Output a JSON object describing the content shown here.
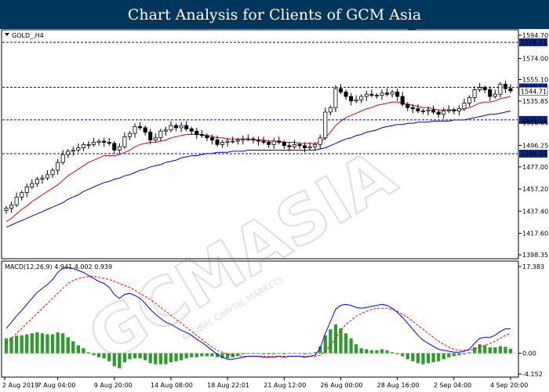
{
  "title": "Chart Analysis for Clients of GCM Asia",
  "chart_data": {
    "type": "candlestick",
    "symbol_label": "GOLD_,H4",
    "indicator_label": "MACD(12,26,9) 4.941 4.002 0.939",
    "price_axis": {
      "ylim": [
        1398.35,
        1594.7
      ],
      "tick_labels": [
        "1594.70",
        "1574.00",
        "1555.10",
        "1535.85",
        "1516.65",
        "1496.25",
        "1477.00",
        "1457.20",
        "1437.40",
        "1417.60",
        "1398.35"
      ],
      "tick_values": [
        1594.7,
        1574.0,
        1555.1,
        1535.85,
        1516.65,
        1496.25,
        1477.0,
        1457.2,
        1437.4,
        1417.6,
        1398.35
      ]
    },
    "horizontal_levels": [
      {
        "value": 1588.41,
        "label": "1588.41"
      },
      {
        "value": 1548.12,
        "label": "1548.12"
      },
      {
        "value": 1519.01,
        "label": "1519.01"
      },
      {
        "value": 1488.84,
        "label": "1488.84"
      }
    ],
    "current_price_label": "1544.71",
    "current_price": 1544.71,
    "macd_axis": {
      "ylim": [
        -4.152,
        17.383
      ],
      "tick_labels": [
        "17.383",
        "0.00",
        "-4.152"
      ],
      "tick_values": [
        17.383,
        0.0,
        -4.152
      ]
    },
    "x_labels": [
      "2 Aug 2019",
      "7 Aug 04:00",
      "9 Aug 20:00",
      "14 Aug 08:00",
      "18 Aug 22:01",
      "21 Aug 12:00",
      "26 Aug 00:00",
      "28 Aug 16:00",
      "2 Sep 04:00",
      "4 Sep 20:00"
    ],
    "x_label_index": [
      0,
      10,
      21,
      32,
      43,
      54,
      65,
      76,
      87,
      98
    ],
    "candles_close": [
      1440,
      1443,
      1450,
      1454,
      1459,
      1462,
      1466,
      1467,
      1470,
      1474,
      1481,
      1488,
      1491,
      1492,
      1494,
      1497,
      1497,
      1499,
      1500,
      1499,
      1498,
      1492,
      1495,
      1504,
      1507,
      1513,
      1512,
      1508,
      1501,
      1503,
      1509,
      1510,
      1514,
      1512,
      1514,
      1511,
      1509,
      1506,
      1505,
      1503,
      1501,
      1497,
      1499,
      1500,
      1500,
      1501,
      1502,
      1502,
      1501,
      1500,
      1499,
      1497,
      1500,
      1499,
      1496,
      1495,
      1497,
      1496,
      1494,
      1495,
      1497,
      1503,
      1526,
      1530,
      1547,
      1544,
      1540,
      1536,
      1537,
      1540,
      1542,
      1541,
      1541,
      1543,
      1542,
      1544,
      1540,
      1533,
      1530,
      1529,
      1527,
      1527,
      1528,
      1526,
      1524,
      1527,
      1528,
      1527,
      1529,
      1534,
      1539,
      1546,
      1548,
      1546,
      1540,
      1542,
      1551,
      1547,
      1545
    ],
    "ema_fast": [
      1428,
      1431,
      1435,
      1439,
      1442,
      1446,
      1449,
      1452,
      1455,
      1458,
      1461,
      1465,
      1469,
      1472,
      1475,
      1478,
      1481,
      1483,
      1485,
      1487,
      1487,
      1487,
      1488,
      1490,
      1492,
      1495,
      1497,
      1498,
      1499,
      1499,
      1500,
      1501,
      1503,
      1504,
      1505,
      1506,
      1506,
      1506,
      1506,
      1505,
      1504,
      1503,
      1503,
      1502,
      1502,
      1502,
      1502,
      1502,
      1501,
      1501,
      1501,
      1500,
      1500,
      1500,
      1499,
      1499,
      1499,
      1498,
      1498,
      1498,
      1498,
      1499,
      1503,
      1508,
      1514,
      1518,
      1521,
      1523,
      1525,
      1527,
      1529,
      1530,
      1532,
      1533,
      1534,
      1535,
      1535,
      1534,
      1533,
      1532,
      1531,
      1530,
      1530,
      1529,
      1528,
      1528,
      1528,
      1528,
      1528,
      1529,
      1530,
      1532,
      1534,
      1535,
      1535,
      1536,
      1538,
      1539,
      1540
    ],
    "ema_slow": [
      1423,
      1425,
      1427,
      1429,
      1431,
      1433,
      1435,
      1437,
      1439,
      1441,
      1443,
      1445,
      1448,
      1450,
      1452,
      1455,
      1457,
      1459,
      1461,
      1463,
      1464,
      1466,
      1467,
      1469,
      1470,
      1472,
      1474,
      1475,
      1477,
      1478,
      1479,
      1481,
      1482,
      1483,
      1485,
      1486,
      1487,
      1487,
      1488,
      1489,
      1489,
      1490,
      1490,
      1490,
      1491,
      1491,
      1491,
      1492,
      1492,
      1492,
      1492,
      1492,
      1492,
      1492,
      1492,
      1492,
      1492,
      1492,
      1492,
      1492,
      1492,
      1493,
      1494,
      1496,
      1498,
      1500,
      1502,
      1503,
      1505,
      1506,
      1508,
      1509,
      1510,
      1512,
      1513,
      1514,
      1515,
      1515,
      1516,
      1516,
      1517,
      1517,
      1517,
      1518,
      1518,
      1518,
      1518,
      1519,
      1519,
      1519,
      1520,
      1521,
      1522,
      1523,
      1524,
      1524,
      1525,
      1526,
      1527
    ],
    "macd_main": [
      5.0,
      6.2,
      7.5,
      8.6,
      9.8,
      11.0,
      12.2,
      13.0,
      13.8,
      14.8,
      16.2,
      17.0,
      17.2,
      17.0,
      16.6,
      16.2,
      15.6,
      15.0,
      14.4,
      14.0,
      13.2,
      11.8,
      11.0,
      11.8,
      12.0,
      11.6,
      11.0,
      10.0,
      8.8,
      7.8,
      7.0,
      6.2,
      5.8,
      5.2,
      4.6,
      4.2,
      3.6,
      2.8,
      2.2,
      1.4,
      0.6,
      -0.2,
      -0.8,
      -1.2,
      -1.2,
      -1.0,
      -0.8,
      -0.6,
      -0.6,
      -0.6,
      -0.8,
      -0.8,
      -0.8,
      -0.6,
      -0.8,
      -0.6,
      -0.6,
      -0.6,
      -0.8,
      -0.6,
      -0.4,
      1.0,
      4.0,
      6.4,
      8.8,
      9.6,
      9.8,
      9.6,
      9.2,
      9.0,
      9.2,
      9.4,
      9.6,
      9.8,
      9.6,
      9.0,
      8.2,
      7.2,
      6.0,
      4.8,
      3.6,
      2.6,
      2.0,
      1.4,
      0.8,
      0.6,
      0.4,
      0.2,
      0.2,
      0.4,
      0.8,
      2.0,
      3.0,
      3.2,
      3.2,
      3.6,
      4.4,
      4.9,
      4.9
    ],
    "macd_signal": [
      2.0,
      3.0,
      4.0,
      5.0,
      6.0,
      7.0,
      8.0,
      9.0,
      10.0,
      11.0,
      12.0,
      13.0,
      14.0,
      14.6,
      15.0,
      15.2,
      15.4,
      15.4,
      15.2,
      15.0,
      14.8,
      14.4,
      14.0,
      13.6,
      13.2,
      12.6,
      12.0,
      11.4,
      10.8,
      10.0,
      9.2,
      8.4,
      7.6,
      6.8,
      6.0,
      5.2,
      4.4,
      3.6,
      2.8,
      2.0,
      1.2,
      0.6,
      0.2,
      -0.2,
      -0.4,
      -0.5,
      -0.6,
      -0.6,
      -0.6,
      -0.6,
      -0.6,
      -0.6,
      -0.6,
      -0.6,
      -0.6,
      -0.6,
      -0.6,
      -0.6,
      -0.6,
      -0.6,
      -0.6,
      -0.4,
      0.4,
      1.6,
      3.0,
      4.6,
      5.8,
      6.6,
      7.4,
      8.0,
      8.4,
      8.8,
      9.0,
      9.0,
      9.0,
      8.8,
      8.4,
      7.8,
      7.2,
      6.4,
      5.6,
      4.8,
      4.0,
      3.2,
      2.4,
      1.8,
      1.2,
      0.8,
      0.6,
      0.6,
      0.6,
      0.8,
      1.2,
      1.6,
      2.0,
      2.4,
      3.0,
      3.6,
      4.0
    ],
    "macd_hist": [
      3.0,
      3.2,
      3.5,
      3.6,
      3.8,
      4.0,
      4.2,
      4.0,
      3.8,
      3.8,
      4.2,
      4.0,
      3.2,
      2.4,
      1.6,
      1.0,
      0.2,
      -0.4,
      -0.8,
      -1.0,
      -1.6,
      -2.6,
      -3.0,
      -1.8,
      -1.2,
      -1.0,
      -1.0,
      -1.4,
      -2.0,
      -2.2,
      -2.2,
      -2.2,
      -1.8,
      -1.6,
      -1.4,
      -1.0,
      -0.8,
      -0.8,
      -0.6,
      -0.6,
      -0.6,
      -0.8,
      -1.0,
      -1.0,
      -0.8,
      -0.5,
      -0.2,
      0.0,
      0.0,
      0.0,
      -0.2,
      -0.2,
      -0.2,
      0.0,
      -0.2,
      0.0,
      0.0,
      0.0,
      -0.2,
      0.0,
      0.2,
      1.4,
      3.6,
      4.8,
      5.8,
      5.0,
      4.0,
      3.0,
      1.8,
      1.0,
      0.8,
      0.6,
      0.6,
      0.8,
      0.6,
      0.2,
      -0.2,
      -0.6,
      -1.2,
      -1.6,
      -2.0,
      -2.2,
      -2.0,
      -1.8,
      -1.6,
      -1.2,
      -0.8,
      -0.6,
      -0.4,
      -0.2,
      0.2,
      1.2,
      1.8,
      1.6,
      1.2,
      1.2,
      1.4,
      1.3,
      0.9
    ],
    "colors": {
      "bull": "#ffffff",
      "bear": "#000000",
      "ema_fast": "#e0000a",
      "ema_slow": "#0000e0",
      "levels": "#0000aa",
      "hist": "#2e9b2e",
      "signal": "#ff0000",
      "macd": "#0000ff",
      "title_bg": "#003659"
    }
  },
  "watermark": {
    "brand": "GCMASIA",
    "tagline": "GLOBAL CAPITAL MARKETS"
  }
}
